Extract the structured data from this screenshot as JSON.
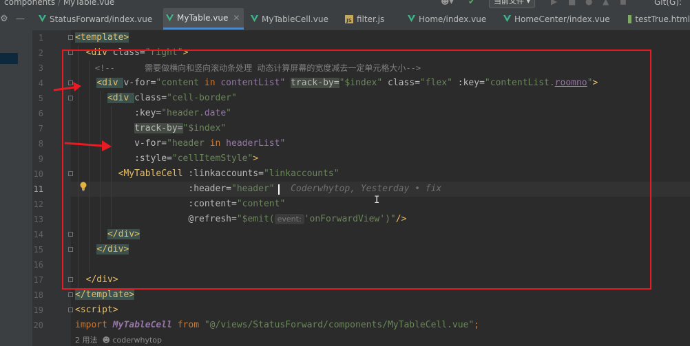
{
  "breadcrumb": {
    "parts": [
      "components",
      "MyTable.vue"
    ],
    "current_file_button": "当前文件",
    "git_label": "Git(G):"
  },
  "tabs": [
    {
      "label": "StatusForward/index.vue",
      "type": "vue",
      "active": false
    },
    {
      "label": "MyTable.vue",
      "type": "vue",
      "active": true
    },
    {
      "label": "MyTableCell.vue",
      "type": "vue",
      "active": false
    },
    {
      "label": "filter.js",
      "type": "js",
      "active": false
    },
    {
      "label": "Home/index.vue",
      "type": "vue",
      "active": false
    },
    {
      "label": "HomeCenter/index.vue",
      "type": "vue",
      "active": false
    },
    {
      "label": "testTrue.html",
      "type": "html",
      "active": false
    }
  ],
  "editor": {
    "line_numbers": [
      "1",
      "2",
      "3",
      "4",
      "5",
      "6",
      "7",
      "8",
      "9",
      "10",
      "11",
      "12",
      "13",
      "14",
      "15",
      "16",
      "17",
      "18",
      "19",
      "20"
    ],
    "current_line": "11",
    "lines": {
      "l1": {
        "open": "<template>"
      },
      "l2": {
        "open": "<div ",
        "attr": "class=",
        "val": "\"right\"",
        "close": ">"
      },
      "l3": {
        "comment": "<!--      需要做横向和竖向滚动条处理 动态计算屏幕的宽度减去一定单元格大小-->"
      },
      "l4": {
        "open": "<div ",
        "a1": "v-for=",
        "v1a": "\"content ",
        "v1kw": "in ",
        "v1b": "contentList\"",
        "a2": "track-by=",
        "v2": "\"$index\"",
        "a3": "class=",
        "v3": "\"flex\"",
        "a4": ":key=",
        "v4a": "\"contentList.",
        "v4b": "roomno",
        "v4c": "\"",
        "close": ">"
      },
      "l5": {
        "open": "<div ",
        "attr": "class=",
        "val": "\"cell-border\""
      },
      "l6": {
        "attr": ":key=",
        "v1": "\"header.",
        "v2": "date",
        "v3": "\""
      },
      "l7": {
        "attr": "track-by=",
        "val": "\"$index\""
      },
      "l8": {
        "attr": "v-for=",
        "v1": "\"header ",
        "kw": "in ",
        "v2": "headerList\""
      },
      "l9": {
        "attr": ":style=",
        "val": "\"cellItemStyle\"",
        "close": ">"
      },
      "l10": {
        "open": "<MyTableCell ",
        "attr": ":linkaccounts=",
        "val": "\"linkaccounts\""
      },
      "l11": {
        "attr": ":header=",
        "val": "\"header\"",
        "blame": "Coderwhytop, Yesterday • fix"
      },
      "l12": {
        "attr": ":content=",
        "val": "\"content\""
      },
      "l13": {
        "attr": "@refresh=",
        "v1": "\"$emit(",
        "hint": "event:",
        "v2": "'onForwardView'",
        "v3": ")\"",
        "close": "/>"
      },
      "l14": {
        "close": "</div>"
      },
      "l15": {
        "close": "</div>"
      },
      "l17": {
        "close": "</div>"
      },
      "l18": {
        "close": "</template>"
      },
      "l19": {
        "open": "<script>"
      },
      "l20": {
        "kw": "import ",
        "name": "MyTableCell ",
        "kw2": "from ",
        "str": "\"@/views/StatusForward/components/MyTableCell.vue\"",
        "end": ";"
      }
    }
  },
  "status": {
    "usages": "2 用法",
    "author": "coderwhytop"
  },
  "colors": {
    "background": "#2b2b2b",
    "tag": "#e8bf6a",
    "string": "#6a8759",
    "keyword": "#cc7832",
    "annotation_box": "#e81b22",
    "active_tab_underline": "#4a88c7"
  },
  "icons": [
    "settings-gear-icon",
    "vue-file-icon",
    "js-file-icon",
    "html-file-icon",
    "lightbulb-icon",
    "close-icon",
    "text-cursor-icon",
    "user-icon",
    "run-icon"
  ]
}
